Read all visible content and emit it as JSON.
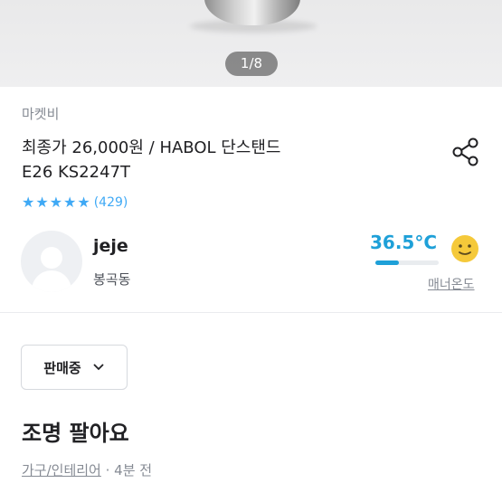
{
  "gallery": {
    "counter": "1/8"
  },
  "product": {
    "store": "마켓비",
    "title_line1": "최종가 26,000원 / HABOL 단스탠드",
    "title_line2": "E26 KS2247T",
    "rating": {
      "stars": 5,
      "count": "(429)"
    }
  },
  "seller": {
    "name": "jeje",
    "location": "봉곡동",
    "temperature": "36.5°C",
    "temperature_level_percent": 36.5,
    "manner_label": "매너온도"
  },
  "status_dropdown": {
    "label": "판매중"
  },
  "post": {
    "title": "조명 팔아요",
    "category": "가구/인테리어",
    "time": " · 4분 전"
  },
  "colors": {
    "accent": "#1ea0d8",
    "star": "#3fa9f5",
    "muted": "#868b94"
  },
  "icons": [
    "share-icon",
    "star-icon",
    "smiley-icon",
    "chevron-down-icon",
    "avatar-placeholder-icon"
  ]
}
